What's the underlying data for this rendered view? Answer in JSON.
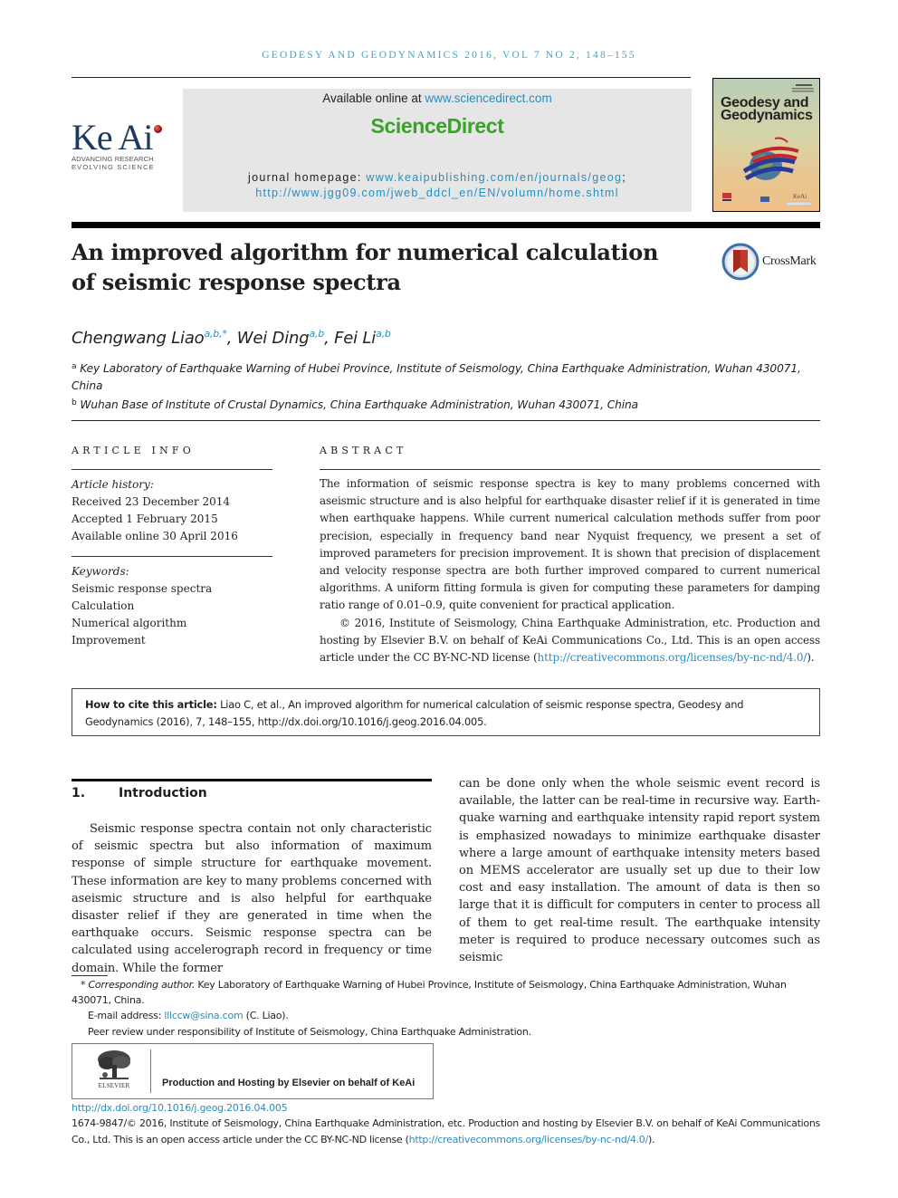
{
  "journal": {
    "running_head": "Geodesy and Geodynamics 2016, vol 7 no 2, 148–155",
    "publisher_logo": {
      "name": "Ke Ai",
      "tagline_1": "ADVANCING RESEARCH",
      "tagline_2": "EVOLVING SCIENCE"
    },
    "sciencedirect": {
      "available_prefix": "Available online at ",
      "available_link": "www.sciencedirect.com",
      "brand": "ScienceDirect",
      "homepage_prefix": "journal homepage: ",
      "homepage_link_1": "www.keaipublishing.com/en/journals/geog",
      "homepage_sep": ";",
      "homepage_link_2": "http://www.jgg09.com/jweb_ddcl_en/EN/volumn/home.shtml",
      "brand_color": "#3aa12b"
    },
    "cover": {
      "title_line_1": "Geodesy and",
      "title_line_2": "Geodynamics",
      "publisher_mark": "KeAi"
    }
  },
  "article": {
    "title_line_1": "An improved algorithm for numerical calculation",
    "title_line_2": "of seismic response spectra",
    "crossmark_label": "CrossMark",
    "authors": [
      {
        "name": "Chengwang Liao",
        "affil": "a,b,*",
        "sep": ", "
      },
      {
        "name": "Wei Ding",
        "affil": "a,b",
        "sep": ", "
      },
      {
        "name": "Fei Li",
        "affil": "a,b",
        "sep": ""
      }
    ],
    "affiliations": [
      {
        "mark": "a",
        "text": "Key Laboratory of Earthquake Warning of Hubei Province, Institute of Seismology, China Earthquake Administration, Wuhan 430071, China"
      },
      {
        "mark": "b",
        "text": "Wuhan Base of Institute of Crustal Dynamics, China Earthquake Administration, Wuhan 430071, China"
      }
    ]
  },
  "article_info": {
    "heading": "ARTICLE INFO",
    "history_label": "Article history:",
    "history": [
      "Received 23 December 2014",
      "Accepted 1 February 2015",
      "Available online 30 April 2016"
    ],
    "keywords_label": "Keywords:",
    "keywords": [
      "Seismic response spectra",
      "Calculation",
      "Numerical algorithm",
      "Improvement"
    ]
  },
  "abstract": {
    "heading": "ABSTRACT",
    "body": "The information of seismic response spectra is key to many problems concerned with aseismic structure and is also helpful for earthquake disaster relief if it is generated in time when earthquake happens. While current numerical calculation methods suffer from poor precision, especially in frequency band near Nyquist frequency, we present a set of improved parameters for precision improvement. It is shown that precision of displace­ment and velocity response spectra are both further improved compared to current nu­merical algorithms. A uniform fitting formula is given for computing these parameters for damping ratio range of 0.01–0.9, quite convenient for practical application.",
    "copyright_prefix": "© 2016, Institute of Seismology, China Earthquake Administration, etc. Production and hosting by Elsevier B.V. on behalf of KeAi Communications Co., Ltd. This is an open access article under the CC BY-NC-ND license (",
    "license_link": "http://creativecommons.org/licenses/by-nc-nd/4.0/",
    "copyright_suffix": ")."
  },
  "citation": {
    "label": "How to cite this article:",
    "text": " Liao C, et al., An improved algorithm for numerical calculation of seismic response spectra, Geodesy and Geodynamics (2016), 7, 148–155, http://dx.doi.org/10.1016/j.geog.2016.04.005."
  },
  "introduction": {
    "number": "1.",
    "heading": "Introduction",
    "col_left": "Seismic response spectra contain not only characteristic of seismic spectra but also information of maximum response of simple structure for earthquake movement. These informa­tion are key to many problems concerned with aseismic structure and is also helpful for earthquake disaster relief if they are generated in time when the earthquake occurs. Seismic response spectra can be calculated using accelero­graph record in frequency or time domain. While the former",
    "col_right": "can be done only when the whole seismic event record is available, the latter can be real-time in recursive way. Earth­quake warning and earthquake intensity rapid report system is emphasized nowadays to minimize earthquake disaster where a large amount of earthquake intensity meters based on MEMS accelerator are usually set up due to their low cost and easy installation. The amount of data is then so large that it is difficult for computers in center to process all of them to get real-time result. The earthquake intensity meter is required to produce necessary outcomes such as seismic"
  },
  "footnotes": {
    "corresponding_mark": "*",
    "corresponding_label": "Corresponding author.",
    "corresponding_text": " Key Laboratory of Earthquake Warning of Hubei Province, Institute of Seismology, China Earthquake Admin­istration, Wuhan 430071, China.",
    "email_label": "E-mail address: ",
    "email": "lllccw@sina.com",
    "email_suffix": " (C. Liao).",
    "peer_review": "Peer review under responsibility of Institute of Seismology, China Earthquake Administration."
  },
  "elsevier": {
    "logo_word": "ELSEVIER",
    "hosting_text": "Production and Hosting by Elsevier on behalf of KeAi"
  },
  "footer": {
    "doi_link": "http://dx.doi.org/10.1016/j.geog.2016.04.005",
    "copyright_prefix": "1674-9847/© 2016, Institute of Seismology, China Earthquake Administration, etc. Production and hosting by Elsevier B.V. on behalf of KeAi Communications Co., Ltd. This is an open access article under the CC BY-NC-ND license (",
    "license_link": "http://creativecommons.org/licenses/by-nc-nd/4.0/",
    "copyright_suffix": ")."
  }
}
